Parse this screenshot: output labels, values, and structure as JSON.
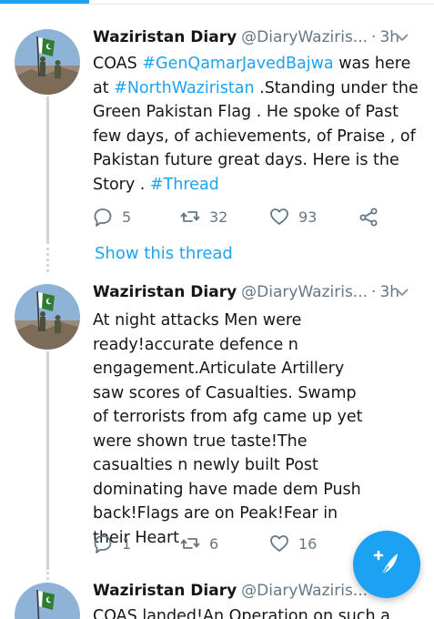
{
  "colors": {
    "accent": "#1da1f2",
    "text": "#14171a",
    "muted": "#657786"
  },
  "tweets": [
    {
      "name": "Waziristan Diary",
      "handle": "@DiaryWaziris...",
      "separator": "·",
      "time": "3h",
      "text_parts": [
        {
          "t": "COAS ",
          "tag": false
        },
        {
          "t": "#GenQamarJavedBajwa",
          "tag": true
        },
        {
          "t": " was here at ",
          "tag": false
        },
        {
          "t": "#NorthWaziristan",
          "tag": true
        },
        {
          "t": " .Standing under the Green Pakistan Flag . He spoke of Past few days, of achievements, of Praise , of Pakistan future great days.  Here is the Story . ",
          "tag": false
        },
        {
          "t": "#Thread",
          "tag": true
        }
      ],
      "replies": "5",
      "retweets": "32",
      "likes": "93"
    },
    {
      "name": "Waziristan Diary",
      "handle": "@DiaryWaziris...",
      "separator": "·",
      "time": "3h",
      "text": "At night attacks Men were ready!accurate defence n engagement.Articulate Artillery saw scores of Casualties. Swamp of terrorists from afg came up yet were shown true taste!The casualties n newly built Post dominating have made dem Push back!Flags are on Peak!Fear in their Heart",
      "replies": "1",
      "retweets": "6",
      "likes": "16"
    },
    {
      "name": "Waziristan Diary",
      "handle": "@DiaryWaziris...",
      "text": "COAS landed!An Operation on such a"
    }
  ],
  "show_thread": "Show this thread",
  "icons": {
    "reply": "reply-icon",
    "retweet": "retweet-icon",
    "like": "heart-icon",
    "share": "share-icon",
    "compose": "compose-tweet-icon",
    "menu": "chevron-down-icon"
  }
}
